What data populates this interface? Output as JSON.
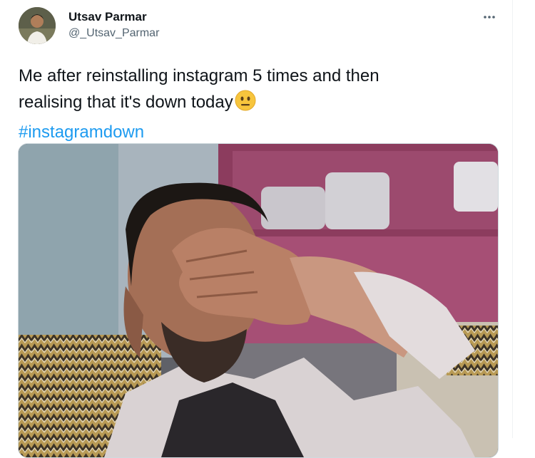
{
  "tweet": {
    "display_name": "Utsav Parmar",
    "handle": "@_Utsav_Parmar",
    "text_line1": "Me after reinstalling instagram 5 times and then",
    "text_line2": "realising that it's down today",
    "emoji": "neutral-face-emoji",
    "hashtag": "#instagramdown"
  },
  "icons": {
    "more": "more-horizontal-icon"
  },
  "colors": {
    "link": "#1d9bf0",
    "text": "#0f1419",
    "secondary": "#536471"
  }
}
